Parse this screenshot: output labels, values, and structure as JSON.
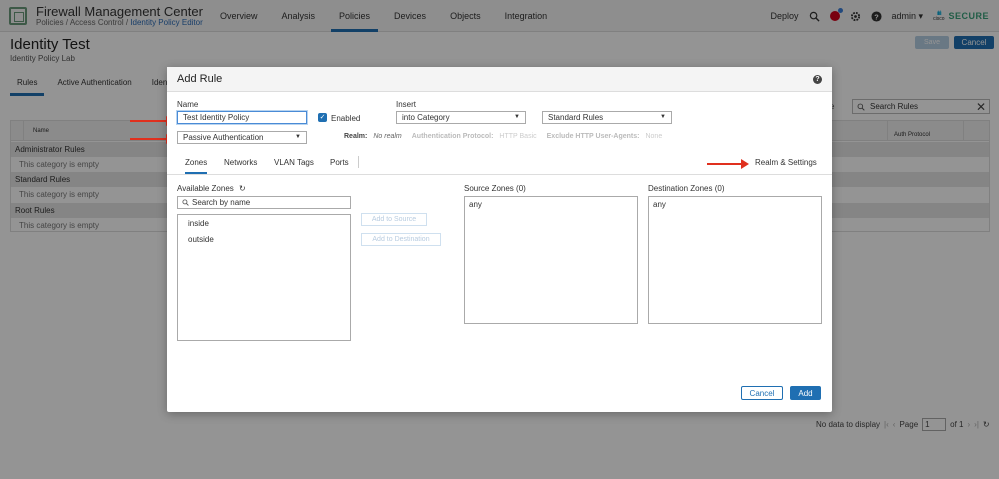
{
  "header": {
    "app_title": "Firewall Management Center",
    "breadcrumb": [
      "Policies",
      "Access Control",
      "Identity Policy Editor"
    ],
    "nav": [
      "Overview",
      "Analysis",
      "Policies",
      "Devices",
      "Objects",
      "Integration"
    ],
    "active_nav": "Policies",
    "deploy": "Deploy",
    "user": "admin",
    "brand_cisco": "cisco",
    "brand_secure": "SECURE"
  },
  "page": {
    "title": "Identity Test",
    "subtitle": "Identity Policy Lab",
    "save_label": "Save",
    "cancel_label": "Cancel",
    "tabs": [
      "Rules",
      "Active Authentication",
      "Identi"
    ],
    "search_placeholder": "Search Rules",
    "rules_suffix": "e",
    "table": {
      "col_name": "Name",
      "col_auth": "Auth Protocol",
      "categories": [
        {
          "name": "Administrator Rules",
          "empty": "This category is empty"
        },
        {
          "name": "Standard Rules",
          "empty": "This category is empty"
        },
        {
          "name": "Root Rules",
          "empty": "This category is empty"
        }
      ]
    },
    "pager": {
      "no_data": "No data to display",
      "page_label": "Page",
      "page_value": "1",
      "of": "of 1"
    }
  },
  "modal": {
    "title": "Add Rule",
    "name_label": "Name",
    "name_value": "Test Identity Policy",
    "enabled_label": "Enabled",
    "insert_label": "Insert",
    "insert_value": "into Category",
    "category_value": "Standard Rules",
    "action_value": "Passive Authentication",
    "realm_label": "Realm:",
    "realm_value": "No realm",
    "auth_protocol_label": "Authentication Protocol:",
    "auth_protocol_value": "HTTP Basic",
    "exclude_label": "Exclude HTTP User-Agents:",
    "exclude_value": "None",
    "tabs": [
      "Zones",
      "Networks",
      "VLAN Tags",
      "Ports"
    ],
    "active_tab": "Zones",
    "realm_settings_tab": "Realm & Settings",
    "available_zones_label": "Available Zones",
    "zone_search_placeholder": "Search by name",
    "available_zones": [
      "inside",
      "outside"
    ],
    "add_to_source": "Add to Source",
    "add_to_destination": "Add to Destination",
    "source_zones_label": "Source Zones (0)",
    "source_zones": [
      "any"
    ],
    "destination_zones_label": "Destination Zones (0)",
    "destination_zones": [
      "any"
    ],
    "cancel_label": "Cancel",
    "add_label": "Add"
  }
}
